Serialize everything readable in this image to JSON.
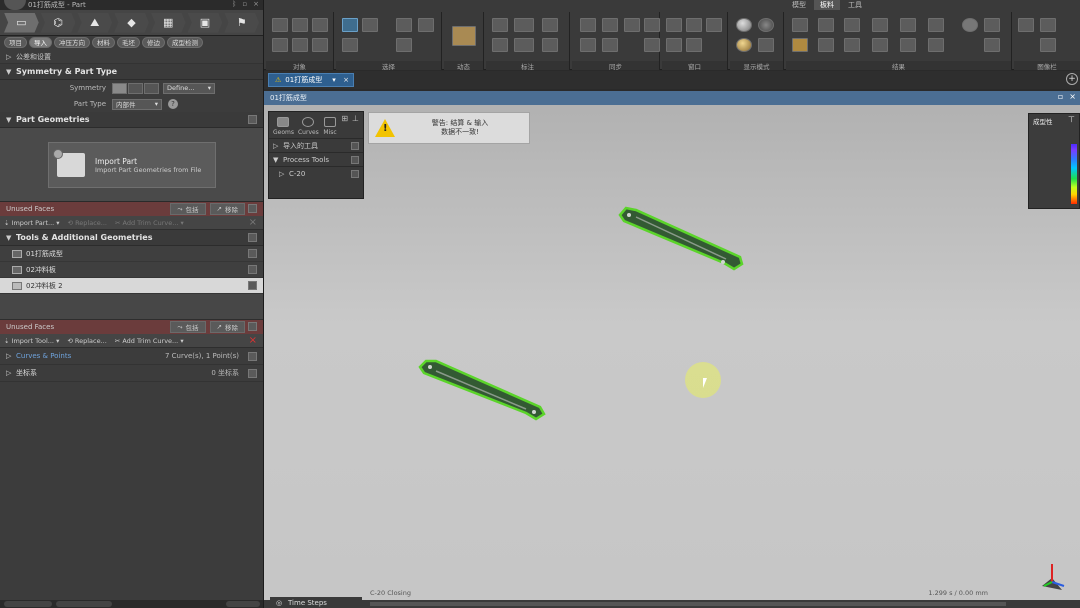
{
  "window": {
    "title": "01打筋成型 - Part"
  },
  "left": {
    "main_tabs": [
      "▭",
      "⌬",
      "⛰",
      "◆",
      "▦",
      "▣",
      "⚑"
    ],
    "sub_tabs": [
      "项目",
      "导入",
      "冲压方向",
      "材料",
      "毛坯",
      "修边",
      "成型检测"
    ],
    "settings_row": "公差和设置",
    "symmetry": {
      "header": "Symmetry & Part Type",
      "symmetry_label": "Symmetry",
      "symmetry_value": "Define...",
      "part_type_label": "Part Type",
      "part_type_value": "内部件"
    },
    "part_geometries": {
      "header": "Part Geometries",
      "import_title": "Import Part",
      "import_desc": "Import Part Geometries from File"
    },
    "unused_faces_1": {
      "label": "Unused Faces",
      "act1": "包括",
      "act2": "移除"
    },
    "import_row_1": {
      "a": "Import Part...",
      "b": "Replace...",
      "c": "Add Trim Curve..."
    },
    "tools": {
      "header": "Tools & Additional Geometries",
      "items": [
        "01打筋成型",
        "02冲料板",
        "02冲料板 2"
      ]
    },
    "unused_faces_2": {
      "label": "Unused Faces",
      "act1": "包括",
      "act2": "移除"
    },
    "import_row_2": {
      "a": "Import Tool...",
      "b": "Replace...",
      "c": "Add Trim Curve..."
    },
    "curves": {
      "label": "Curves & Points",
      "count": "7 Curve(s), 1 Point(s)"
    },
    "coords": {
      "label": "坐标系",
      "count": "0 坐标系"
    }
  },
  "toolbar": {
    "ribbon_tabs": [
      "模型",
      "板料",
      "工具"
    ],
    "groups": [
      "对象",
      "选择",
      "动态",
      "标注",
      "同步",
      "窗口",
      "显示模式",
      "结果",
      "图像栏"
    ]
  },
  "doc": {
    "tab_label": "01打筋成型"
  },
  "viewport": {
    "title": "01打筋成型",
    "side_tabs": [
      "Geoms",
      "Curves",
      "Misc"
    ],
    "side_rows": [
      "导入的工具",
      "Process Tools",
      "C-20"
    ],
    "warning_line1": "警告: 结算 & 输入",
    "warning_line2": "数据不一致!",
    "legend_title": "成型性",
    "status_left": "C-20 Closing",
    "status_right": "1.299 s / 0.00 mm",
    "time_steps": "Time Steps",
    "colors": {
      "part_fill": "#335a33",
      "part_edge": "#5bd42a",
      "title_bg": "#4b6e93"
    }
  }
}
